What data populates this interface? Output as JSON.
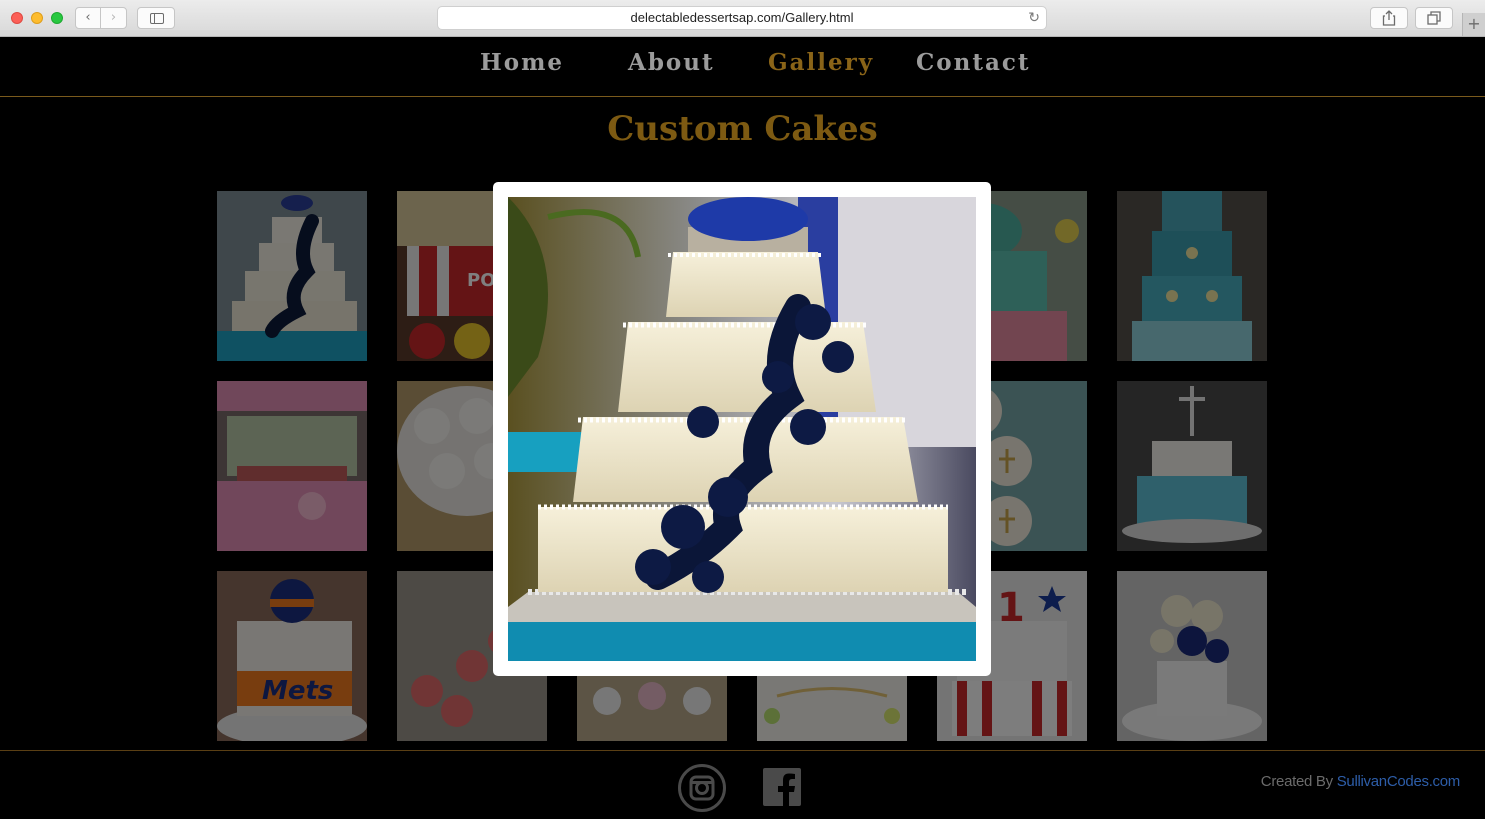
{
  "browser": {
    "url": "delectabledessertsap.com/Gallery.html",
    "back_icon": "chevron-left-icon",
    "forward_icon": "chevron-right-icon",
    "reload_icon": "reload-icon",
    "share_icon": "share-icon",
    "tabs_icon": "tabs-icon",
    "new_tab_icon": "plus-icon"
  },
  "nav": {
    "items": [
      {
        "label": "Home"
      },
      {
        "label": "About"
      },
      {
        "label": "Gallery",
        "active": true
      },
      {
        "label": "Contact"
      }
    ],
    "active_color": "#8a6418"
  },
  "page": {
    "title": "Custom Cakes",
    "title_color": "#7d5a12"
  },
  "gallery": {
    "rows": 3,
    "columns": 6,
    "thumbnails": [
      "wedding-cake-navy-flowers",
      "popcorn-cake",
      "cake-3",
      "cake-4",
      "teal-tiered-cake",
      "teal-floral-cake",
      "party-table-pink",
      "white-cupcakes",
      "cake-9",
      "cake-10",
      "cross-cupcakes",
      "blue-rosette-cross-cake",
      "mets-cake",
      "pink-cupcakes",
      "cupcakes-box",
      "white-sheet-cake",
      "first-birthday-star-cake",
      "white-rose-navy-cake"
    ]
  },
  "lightbox": {
    "open": true,
    "image": "wedding-cake-navy-flowers"
  },
  "footer": {
    "credit_prefix": "Created By ",
    "credit_link": "SullivanCodes.com",
    "instagram_icon": "instagram-icon",
    "facebook_icon": "facebook-icon"
  }
}
